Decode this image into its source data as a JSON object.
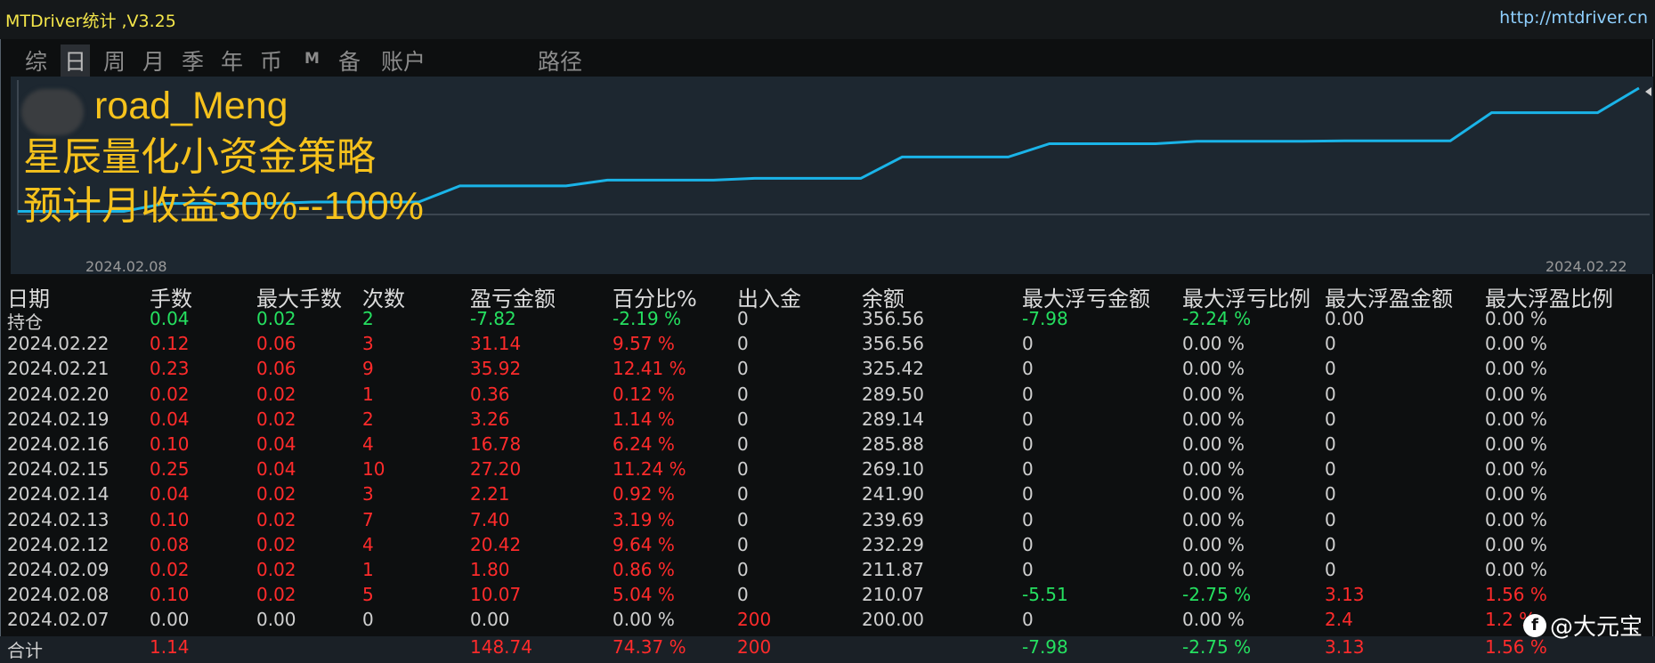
{
  "window": {
    "title": "MTDriver统计 ,V3.25",
    "site": "http://mtdriver.cn"
  },
  "tabs": [
    {
      "label": "综",
      "active": false
    },
    {
      "label": "日",
      "active": true
    },
    {
      "label": "周",
      "active": false
    },
    {
      "label": "月",
      "active": false
    },
    {
      "label": "季",
      "active": false
    },
    {
      "label": "年",
      "active": false
    },
    {
      "label": "币",
      "active": false
    },
    {
      "label": "M",
      "active": false
    },
    {
      "label": "备",
      "active": false
    },
    {
      "label": "账户",
      "active": false
    },
    {
      "label": "路径",
      "active": false
    }
  ],
  "overlay": {
    "line1": "road_Meng",
    "line2": "星辰量化小资金策略",
    "line3": "预计月收益30%--100%"
  },
  "colors": {
    "line": "#1ab4e8",
    "overlay_text": "#f6c21c",
    "positive": "#ff2b2b",
    "negative": "#25e060"
  },
  "chart_data": {
    "type": "line",
    "x_start_label": "2024.02.08",
    "x_end_label": "2024.02.22",
    "x": [
      "2024.02.07",
      "2024.02.08",
      "2024.02.09",
      "2024.02.12",
      "2024.02.13",
      "2024.02.14",
      "2024.02.15",
      "2024.02.16",
      "2024.02.19",
      "2024.02.20",
      "2024.02.21",
      "2024.02.22"
    ],
    "values": [
      200.0,
      210.07,
      211.87,
      232.29,
      239.69,
      241.9,
      269.1,
      285.88,
      289.14,
      289.5,
      325.42,
      356.56
    ],
    "ylim": [
      196,
      360
    ]
  },
  "table": {
    "headers": [
      "日期",
      "手数",
      "最大手数",
      "次数",
      "盈亏金额",
      "百分比%",
      "出入金",
      "余额",
      "最大浮亏金额",
      "最大浮亏比例",
      "最大浮盈金额",
      "最大浮盈比例"
    ],
    "rows": [
      {
        "date": "持仓",
        "lots": "0.04",
        "max_lots": "0.02",
        "count": "2",
        "pnl": "-7.82",
        "pct": "-2.19 %",
        "io": "0",
        "balance": "356.56",
        "max_float_loss": "-7.98",
        "max_float_loss_pct": "-2.24 %",
        "max_float_profit": "0.00",
        "max_float_profit_pct": "0.00 %",
        "tone": "green"
      },
      {
        "date": "2024.02.22",
        "lots": "0.12",
        "max_lots": "0.06",
        "count": "3",
        "pnl": "31.14",
        "pct": "9.57 %",
        "io": "0",
        "balance": "356.56",
        "max_float_loss": "0",
        "max_float_loss_pct": "0.00 %",
        "max_float_profit": "0",
        "max_float_profit_pct": "0.00 %",
        "tone": "red"
      },
      {
        "date": "2024.02.21",
        "lots": "0.23",
        "max_lots": "0.06",
        "count": "9",
        "pnl": "35.92",
        "pct": "12.41 %",
        "io": "0",
        "balance": "325.42",
        "max_float_loss": "0",
        "max_float_loss_pct": "0.00 %",
        "max_float_profit": "0",
        "max_float_profit_pct": "0.00 %",
        "tone": "red"
      },
      {
        "date": "2024.02.20",
        "lots": "0.02",
        "max_lots": "0.02",
        "count": "1",
        "pnl": "0.36",
        "pct": "0.12 %",
        "io": "0",
        "balance": "289.50",
        "max_float_loss": "0",
        "max_float_loss_pct": "0.00 %",
        "max_float_profit": "0",
        "max_float_profit_pct": "0.00 %",
        "tone": "red"
      },
      {
        "date": "2024.02.19",
        "lots": "0.04",
        "max_lots": "0.02",
        "count": "2",
        "pnl": "3.26",
        "pct": "1.14 %",
        "io": "0",
        "balance": "289.14",
        "max_float_loss": "0",
        "max_float_loss_pct": "0.00 %",
        "max_float_profit": "0",
        "max_float_profit_pct": "0.00 %",
        "tone": "red"
      },
      {
        "date": "2024.02.16",
        "lots": "0.10",
        "max_lots": "0.04",
        "count": "4",
        "pnl": "16.78",
        "pct": "6.24 %",
        "io": "0",
        "balance": "285.88",
        "max_float_loss": "0",
        "max_float_loss_pct": "0.00 %",
        "max_float_profit": "0",
        "max_float_profit_pct": "0.00 %",
        "tone": "red"
      },
      {
        "date": "2024.02.15",
        "lots": "0.25",
        "max_lots": "0.04",
        "count": "10",
        "pnl": "27.20",
        "pct": "11.24 %",
        "io": "0",
        "balance": "269.10",
        "max_float_loss": "0",
        "max_float_loss_pct": "0.00 %",
        "max_float_profit": "0",
        "max_float_profit_pct": "0.00 %",
        "tone": "red"
      },
      {
        "date": "2024.02.14",
        "lots": "0.04",
        "max_lots": "0.02",
        "count": "3",
        "pnl": "2.21",
        "pct": "0.92 %",
        "io": "0",
        "balance": "241.90",
        "max_float_loss": "0",
        "max_float_loss_pct": "0.00 %",
        "max_float_profit": "0",
        "max_float_profit_pct": "0.00 %",
        "tone": "red"
      },
      {
        "date": "2024.02.13",
        "lots": "0.10",
        "max_lots": "0.02",
        "count": "7",
        "pnl": "7.40",
        "pct": "3.19 %",
        "io": "0",
        "balance": "239.69",
        "max_float_loss": "0",
        "max_float_loss_pct": "0.00 %",
        "max_float_profit": "0",
        "max_float_profit_pct": "0.00 %",
        "tone": "red"
      },
      {
        "date": "2024.02.12",
        "lots": "0.08",
        "max_lots": "0.02",
        "count": "4",
        "pnl": "20.42",
        "pct": "9.64 %",
        "io": "0",
        "balance": "232.29",
        "max_float_loss": "0",
        "max_float_loss_pct": "0.00 %",
        "max_float_profit": "0",
        "max_float_profit_pct": "0.00 %",
        "tone": "red"
      },
      {
        "date": "2024.02.09",
        "lots": "0.02",
        "max_lots": "0.02",
        "count": "1",
        "pnl": "1.80",
        "pct": "0.86 %",
        "io": "0",
        "balance": "211.87",
        "max_float_loss": "0",
        "max_float_loss_pct": "0.00 %",
        "max_float_profit": "0",
        "max_float_profit_pct": "0.00 %",
        "tone": "red"
      },
      {
        "date": "2024.02.08",
        "lots": "0.10",
        "max_lots": "0.02",
        "count": "5",
        "pnl": "10.07",
        "pct": "5.04 %",
        "io": "0",
        "balance": "210.07",
        "max_float_loss": "-5.51",
        "max_float_loss_pct": "-2.75 %",
        "max_float_profit": "3.13",
        "max_float_profit_pct": "1.56 %",
        "tone": "red"
      },
      {
        "date": "2024.02.07",
        "lots": "0.00",
        "max_lots": "0.00",
        "count": "0",
        "pnl": "0.00",
        "pct": "0.00 %",
        "io": "200",
        "balance": "200.00",
        "max_float_loss": "0",
        "max_float_loss_pct": "0.00 %",
        "max_float_profit": "2.4",
        "max_float_profit_pct": "1.2 %",
        "tone": "grey"
      }
    ],
    "total": {
      "date": "合计",
      "lots": "1.14",
      "max_lots": "",
      "count": "",
      "pnl": "148.74",
      "pct": "74.37 %",
      "io": "200",
      "balance": "",
      "max_float_loss": "-7.98",
      "max_float_loss_pct": "-2.75 %",
      "max_float_profit": "3.13",
      "max_float_profit_pct": "1.56 %"
    }
  },
  "watermark": "@大元宝"
}
